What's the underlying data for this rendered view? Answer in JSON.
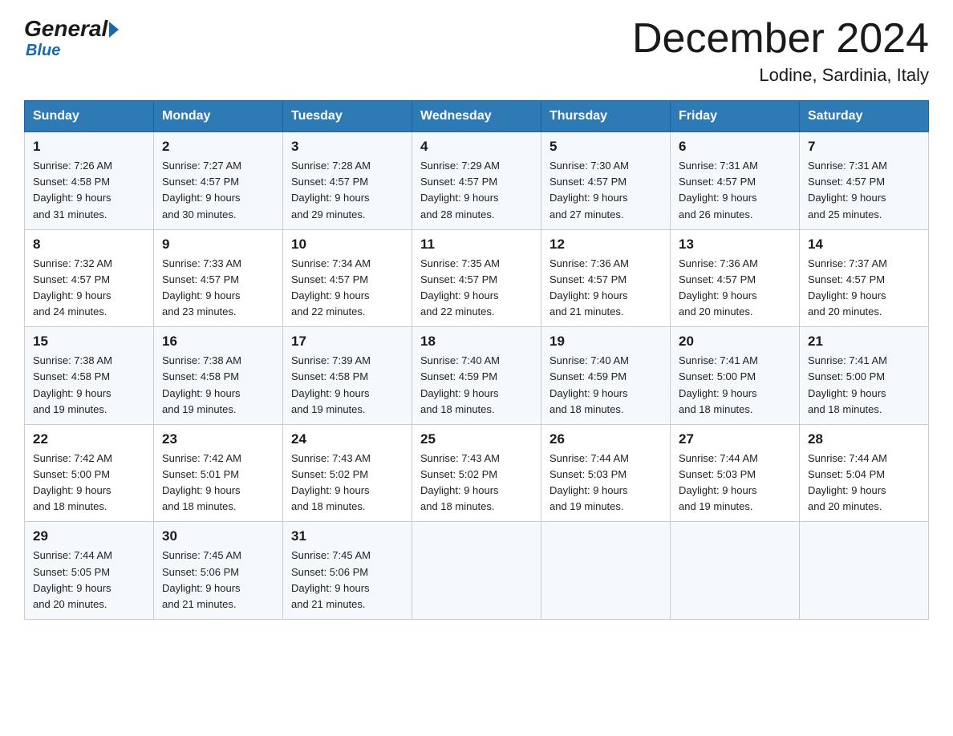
{
  "header": {
    "logo_general": "General",
    "logo_blue": "Blue",
    "month_title": "December 2024",
    "location": "Lodine, Sardinia, Italy"
  },
  "days_of_week": [
    "Sunday",
    "Monday",
    "Tuesday",
    "Wednesday",
    "Thursday",
    "Friday",
    "Saturday"
  ],
  "weeks": [
    [
      {
        "day": "1",
        "sunrise": "7:26 AM",
        "sunset": "4:58 PM",
        "daylight": "9 hours and 31 minutes."
      },
      {
        "day": "2",
        "sunrise": "7:27 AM",
        "sunset": "4:57 PM",
        "daylight": "9 hours and 30 minutes."
      },
      {
        "day": "3",
        "sunrise": "7:28 AM",
        "sunset": "4:57 PM",
        "daylight": "9 hours and 29 minutes."
      },
      {
        "day": "4",
        "sunrise": "7:29 AM",
        "sunset": "4:57 PM",
        "daylight": "9 hours and 28 minutes."
      },
      {
        "day": "5",
        "sunrise": "7:30 AM",
        "sunset": "4:57 PM",
        "daylight": "9 hours and 27 minutes."
      },
      {
        "day": "6",
        "sunrise": "7:31 AM",
        "sunset": "4:57 PM",
        "daylight": "9 hours and 26 minutes."
      },
      {
        "day": "7",
        "sunrise": "7:31 AM",
        "sunset": "4:57 PM",
        "daylight": "9 hours and 25 minutes."
      }
    ],
    [
      {
        "day": "8",
        "sunrise": "7:32 AM",
        "sunset": "4:57 PM",
        "daylight": "9 hours and 24 minutes."
      },
      {
        "day": "9",
        "sunrise": "7:33 AM",
        "sunset": "4:57 PM",
        "daylight": "9 hours and 23 minutes."
      },
      {
        "day": "10",
        "sunrise": "7:34 AM",
        "sunset": "4:57 PM",
        "daylight": "9 hours and 22 minutes."
      },
      {
        "day": "11",
        "sunrise": "7:35 AM",
        "sunset": "4:57 PM",
        "daylight": "9 hours and 22 minutes."
      },
      {
        "day": "12",
        "sunrise": "7:36 AM",
        "sunset": "4:57 PM",
        "daylight": "9 hours and 21 minutes."
      },
      {
        "day": "13",
        "sunrise": "7:36 AM",
        "sunset": "4:57 PM",
        "daylight": "9 hours and 20 minutes."
      },
      {
        "day": "14",
        "sunrise": "7:37 AM",
        "sunset": "4:57 PM",
        "daylight": "9 hours and 20 minutes."
      }
    ],
    [
      {
        "day": "15",
        "sunrise": "7:38 AM",
        "sunset": "4:58 PM",
        "daylight": "9 hours and 19 minutes."
      },
      {
        "day": "16",
        "sunrise": "7:38 AM",
        "sunset": "4:58 PM",
        "daylight": "9 hours and 19 minutes."
      },
      {
        "day": "17",
        "sunrise": "7:39 AM",
        "sunset": "4:58 PM",
        "daylight": "9 hours and 19 minutes."
      },
      {
        "day": "18",
        "sunrise": "7:40 AM",
        "sunset": "4:59 PM",
        "daylight": "9 hours and 18 minutes."
      },
      {
        "day": "19",
        "sunrise": "7:40 AM",
        "sunset": "4:59 PM",
        "daylight": "9 hours and 18 minutes."
      },
      {
        "day": "20",
        "sunrise": "7:41 AM",
        "sunset": "5:00 PM",
        "daylight": "9 hours and 18 minutes."
      },
      {
        "day": "21",
        "sunrise": "7:41 AM",
        "sunset": "5:00 PM",
        "daylight": "9 hours and 18 minutes."
      }
    ],
    [
      {
        "day": "22",
        "sunrise": "7:42 AM",
        "sunset": "5:00 PM",
        "daylight": "9 hours and 18 minutes."
      },
      {
        "day": "23",
        "sunrise": "7:42 AM",
        "sunset": "5:01 PM",
        "daylight": "9 hours and 18 minutes."
      },
      {
        "day": "24",
        "sunrise": "7:43 AM",
        "sunset": "5:02 PM",
        "daylight": "9 hours and 18 minutes."
      },
      {
        "day": "25",
        "sunrise": "7:43 AM",
        "sunset": "5:02 PM",
        "daylight": "9 hours and 18 minutes."
      },
      {
        "day": "26",
        "sunrise": "7:44 AM",
        "sunset": "5:03 PM",
        "daylight": "9 hours and 19 minutes."
      },
      {
        "day": "27",
        "sunrise": "7:44 AM",
        "sunset": "5:03 PM",
        "daylight": "9 hours and 19 minutes."
      },
      {
        "day": "28",
        "sunrise": "7:44 AM",
        "sunset": "5:04 PM",
        "daylight": "9 hours and 20 minutes."
      }
    ],
    [
      {
        "day": "29",
        "sunrise": "7:44 AM",
        "sunset": "5:05 PM",
        "daylight": "9 hours and 20 minutes."
      },
      {
        "day": "30",
        "sunrise": "7:45 AM",
        "sunset": "5:06 PM",
        "daylight": "9 hours and 21 minutes."
      },
      {
        "day": "31",
        "sunrise": "7:45 AM",
        "sunset": "5:06 PM",
        "daylight": "9 hours and 21 minutes."
      },
      null,
      null,
      null,
      null
    ]
  ],
  "labels": {
    "sunrise": "Sunrise:",
    "sunset": "Sunset:",
    "daylight": "Daylight:"
  }
}
